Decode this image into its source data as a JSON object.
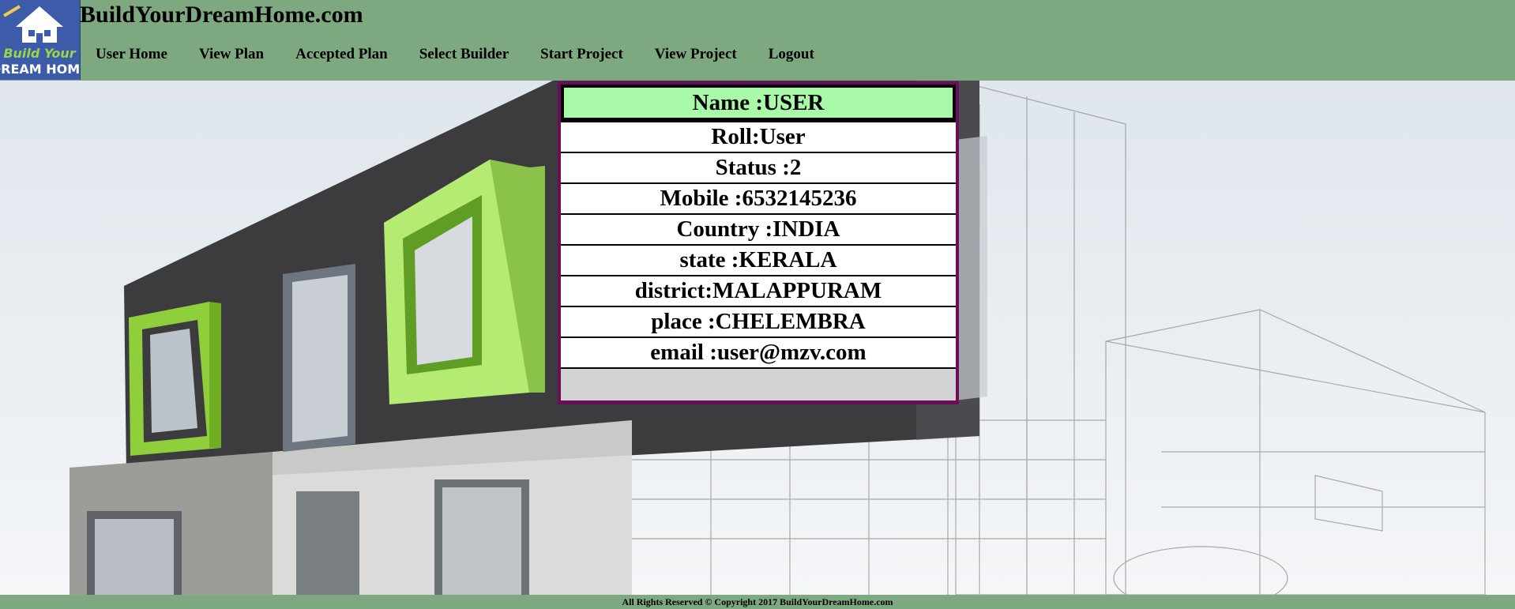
{
  "site": {
    "title": "BuildYourDreamHome.com"
  },
  "logo": {
    "line1": "Build Your",
    "line2": "DREAM HOME"
  },
  "nav": {
    "items": [
      {
        "label": "User Home"
      },
      {
        "label": "View Plan"
      },
      {
        "label": "Accepted Plan"
      },
      {
        "label": "Select Builder"
      },
      {
        "label": "Start Project"
      },
      {
        "label": "View Project"
      },
      {
        "label": "Logout"
      }
    ]
  },
  "profile": {
    "name": "Name :USER",
    "roll": "Roll:User",
    "status": "Status :2",
    "mobile": "Mobile :6532145236",
    "country": "Country :INDIA",
    "state": "state :KERALA",
    "district": "district:MALAPPURAM",
    "place": "place :CHELEMBRA",
    "email": "email :user@mzv.com"
  },
  "footer": {
    "text": "All Rights Reserved © Copyright 2017 BuildYourDreamHome.com"
  },
  "colors": {
    "header_bg": "#7ea87f",
    "name_bg": "#a8f9a8",
    "profile_border": "#6c0d5c",
    "accent_green": "#9bd34a"
  }
}
